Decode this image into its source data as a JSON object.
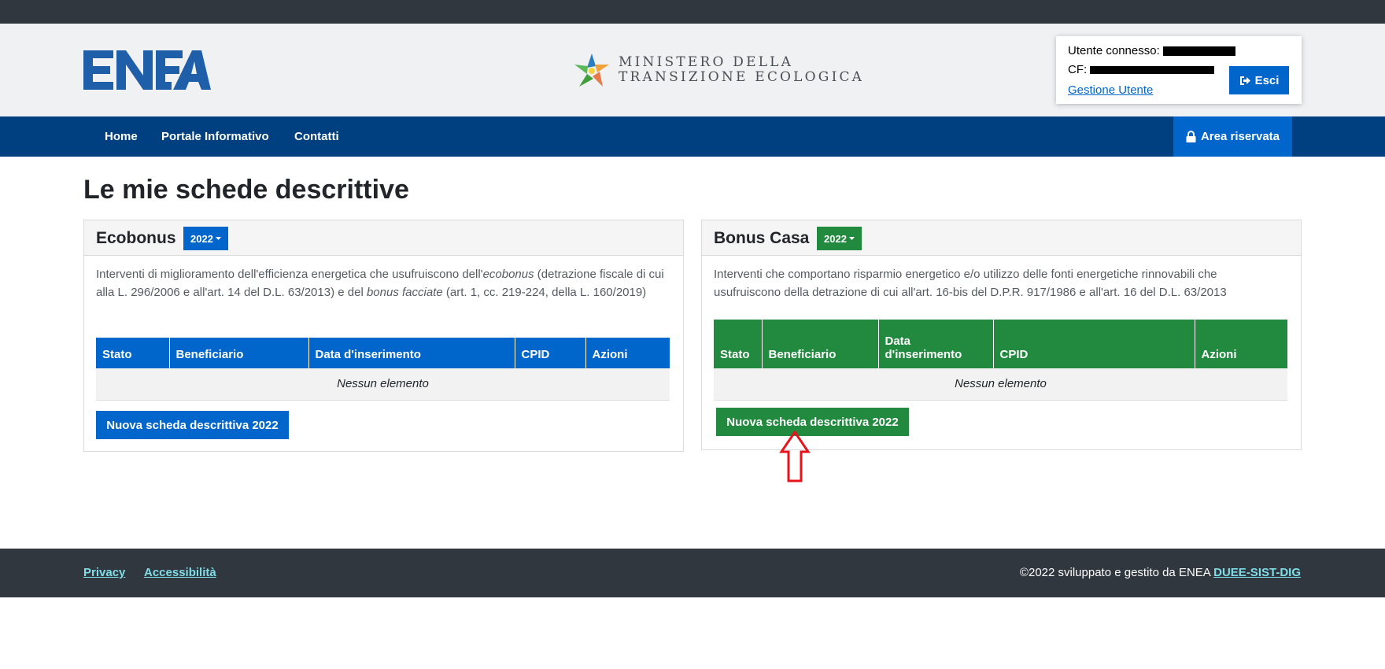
{
  "header": {
    "ministry_line1": "MINISTERO DELLA",
    "ministry_line2": "TRANSIZIONE ECOLOGICA",
    "user_label": "Utente connesso:",
    "cf_label": "CF:",
    "user_link": "Gestione Utente",
    "logout_label": "Esci"
  },
  "nav": {
    "items": [
      "Home",
      "Portale Informativo",
      "Contatti"
    ],
    "reserved_label": "Area riservata"
  },
  "page_title": "Le mie schede descrittive",
  "cards": [
    {
      "title": "Ecobonus",
      "year": "2022",
      "desc_parts": [
        "Interventi di miglioramento dell'efficienza energetica che usufruiscono dell'",
        "ecobonus",
        " (detrazione fiscale di cui alla L. 296/2006 e all'art. 14 del D.L. 63/2013) e del ",
        "bonus facciate",
        " (art. 1, cc. 219-224, della L. 160/2019)"
      ],
      "columns": [
        "Stato",
        "Beneficiario",
        "Data d'inserimento",
        "CPID",
        "Azioni"
      ],
      "empty_text": "Nessun elemento",
      "new_button": "Nuova scheda descrittiva 2022",
      "color": "#0066cc"
    },
    {
      "title": "Bonus Casa",
      "year": "2022",
      "description": "Interventi che comportano risparmio energetico e/o utilizzo delle fonti energetiche rinnovabili che usufruiscono della detrazione di cui all'art. 16-bis del D.P.R. 917/1986 e all'art. 16 del D.L. 63/2013",
      "columns": [
        "Stato",
        "Beneficiario",
        "Data d'inserimento",
        "CPID",
        "Azioni"
      ],
      "empty_text": "Nessun elemento",
      "new_button": "Nuova scheda descrittiva 2022",
      "color": "#218a3f"
    }
  ],
  "footer": {
    "privacy": "Privacy",
    "accessibility": "Accessibilità",
    "credit": "©2022 sviluppato e gestito da ENEA",
    "credit_link": "DUEE-SIST-DIG"
  },
  "colors": {
    "nav_bg": "#004080",
    "primary": "#0066cc",
    "success": "#218a3f",
    "dark": "#30373e",
    "annotation": "#e8141c"
  }
}
